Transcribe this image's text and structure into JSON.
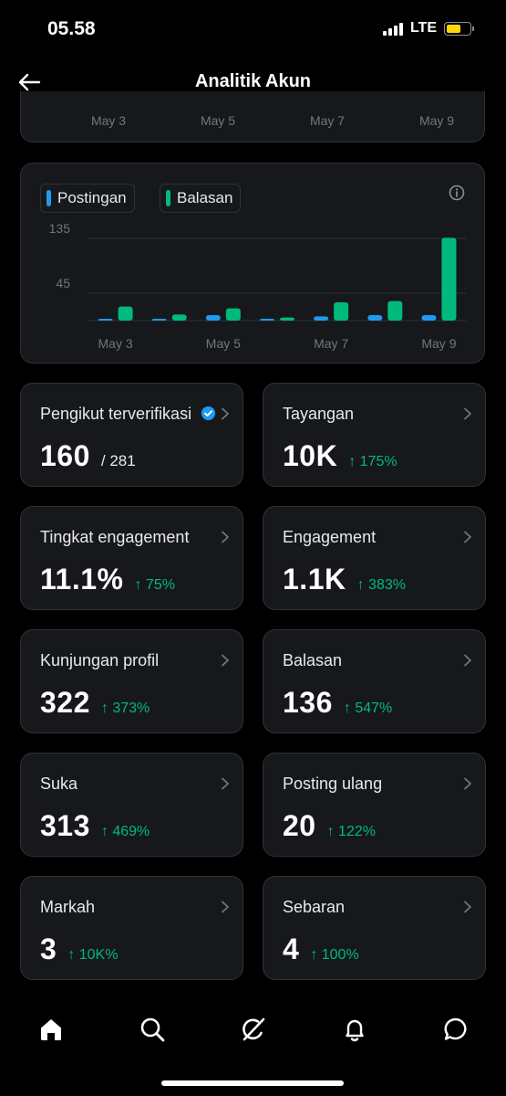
{
  "status_bar": {
    "time": "05.58",
    "network": "LTE"
  },
  "header": {
    "title": "Analitik Akun"
  },
  "top_chart_axis": {
    "labels": [
      "May 3",
      "May 5",
      "May 7",
      "May 9"
    ]
  },
  "activity_chart": {
    "legend": {
      "posts_label": "Postingan",
      "replies_label": "Balasan"
    },
    "colors": {
      "posts": "#1d9bf0",
      "replies": "#00ba7c"
    }
  },
  "chart_data": {
    "type": "bar",
    "categories": [
      "May 3",
      "May 4",
      "May 5",
      "May 6",
      "May 7",
      "May 8",
      "May 9"
    ],
    "x_tick_labels": [
      "May 3",
      "May 5",
      "May 7",
      "May 9"
    ],
    "y_tick_labels": [
      "135",
      "45"
    ],
    "ylim": [
      0,
      135
    ],
    "series": [
      {
        "name": "Postingan",
        "color": "#1d9bf0",
        "values": [
          1,
          1,
          9,
          1,
          7,
          9,
          9
        ]
      },
      {
        "name": "Balasan",
        "color": "#00ba7c",
        "values": [
          23,
          10,
          20,
          5,
          30,
          32,
          136
        ]
      }
    ],
    "grid": true
  },
  "stats": [
    {
      "label": "Pengikut terverifikasi",
      "value": "160",
      "sub": "/ 281",
      "change": "↑ 175%",
      "verified": true
    },
    {
      "label": "Tayangan",
      "value": "10K",
      "change": "↑ 175%"
    },
    {
      "label": "Tingkat engagement",
      "value": "11.1%",
      "change": "↑ 75%"
    },
    {
      "label": "Engagement",
      "value": "1.1K",
      "change": "↑ 383%"
    },
    {
      "label": "Kunjungan profil",
      "value": "322",
      "change": "↑ 373%"
    },
    {
      "label": "Balasan",
      "value": "136",
      "change": "↑ 547%"
    },
    {
      "label": "Suka",
      "value": "313",
      "change": "↑ 469%"
    },
    {
      "label": "Posting ulang",
      "value": "20",
      "change": "↑ 122%"
    },
    {
      "label": "Markah",
      "value": "3",
      "change": "↑ 10K%"
    },
    {
      "label": "Sebaran",
      "value": "4",
      "change": "↑ 100%"
    }
  ],
  "bottom_nav": {
    "icons": [
      "home-icon",
      "search-icon",
      "grok-icon",
      "notifications-icon",
      "messages-icon"
    ]
  }
}
